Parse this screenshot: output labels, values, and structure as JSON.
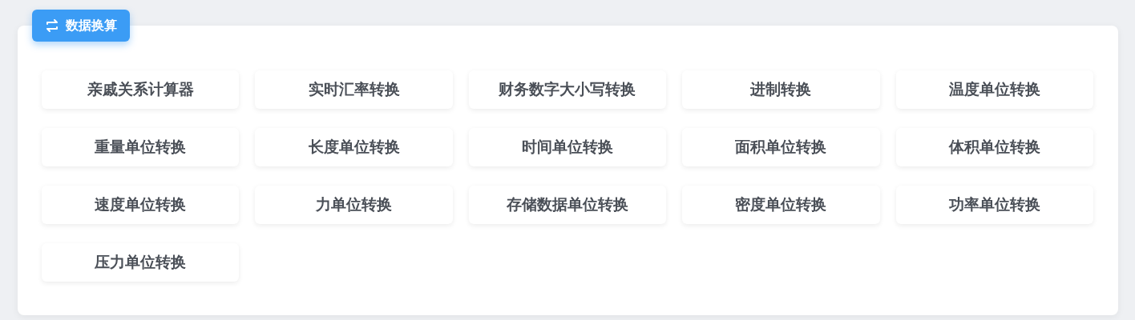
{
  "header_tab": {
    "label": "数据换算",
    "selected": true
  },
  "tools": [
    {
      "label": "亲戚关系计算器"
    },
    {
      "label": "实时汇率转换"
    },
    {
      "label": "财务数字大小写转换"
    },
    {
      "label": "进制转换"
    },
    {
      "label": "温度单位转换"
    },
    {
      "label": "重量单位转换"
    },
    {
      "label": "长度单位转换"
    },
    {
      "label": "时间单位转换"
    },
    {
      "label": "面积单位转换"
    },
    {
      "label": "体积单位转换"
    },
    {
      "label": "速度单位转换"
    },
    {
      "label": "力单位转换"
    },
    {
      "label": "存储数据单位转换"
    },
    {
      "label": "密度单位转换"
    },
    {
      "label": "功率单位转换"
    },
    {
      "label": "压力单位转换"
    }
  ]
}
